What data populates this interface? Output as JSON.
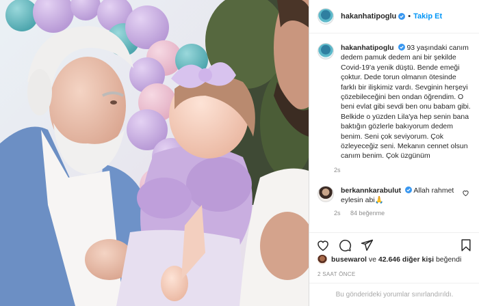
{
  "header": {
    "username": "hakanhatipoglu",
    "follow_label": "Takip Et",
    "separator": "•"
  },
  "caption": {
    "username": "hakanhatipoglu",
    "text": "93 yaşındaki canım dedem pamuk dedem ani bir şekilde Covid-19'a yenik düştü. Bende emeği çoktur. Dede torun olmanın ötesinde farklı bir ilişkimiz vardı. Sevginin herşeyi çözebileceğini ben ondan öğrendim. O beni evlat gibi sevdi ben onu babam gibi. Belkide o yüzden Lila'ya hep senin bana baktığın gözlerle bakıyorum dedem benim. Seni çok seviyorum. Çok özleyeceğiz seni. Mekanın cennet olsun canım benim. Çok üzgünüm",
    "age": "2s"
  },
  "comment": {
    "username": "berkannkarabulut",
    "text": "Allah rahmet eylesin abi🙏",
    "age": "2s",
    "likes": "84 beğenme"
  },
  "likes": {
    "username": "busewarol",
    "connector": "ve",
    "others": "42.646 diğer kişi",
    "suffix": "beğendi"
  },
  "timestamp": "2 SAAT ÖNCE",
  "footer_note": "Bu gönderideki yorumlar sınırlandırıldı.",
  "colors": {
    "link_blue": "#0095f6",
    "verified_blue": "#3897f0",
    "muted": "#8e8e8e"
  },
  "photo": {
    "description_icon": "photo-post-image"
  }
}
